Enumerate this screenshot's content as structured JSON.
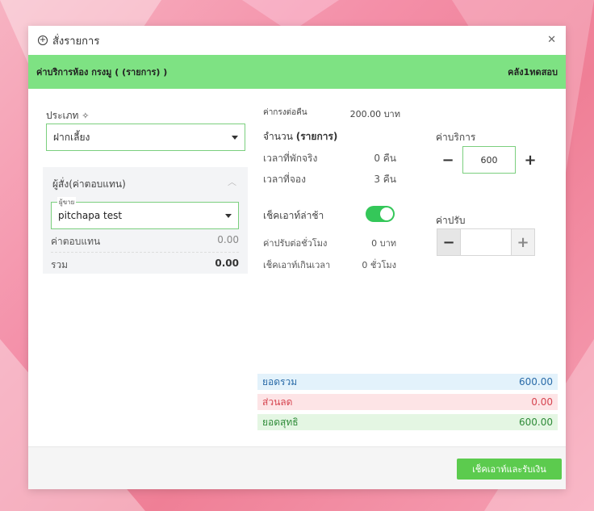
{
  "modal": {
    "title": "สั่งรายการ",
    "bar_left": "ค่าบริการห้อง กรงมู ( (รายการ) )",
    "bar_right": "คลัง1ทดสอบ"
  },
  "left": {
    "type_label": "ประเภท",
    "type_value": "ฝากเลี้ยง",
    "panel_title": "ผู้สั่ง(ค่าตอบแทน)",
    "seller_legend": "ผู้ขาย",
    "seller_value": "pitchapa test",
    "commission_label": "ค่าตอบแทน",
    "commission_value": "0.00",
    "sum_label": "รวม",
    "sum_value": "0.00"
  },
  "middle": {
    "price_per_night_label": "ค่ากรงต่อคืน",
    "price_per_night_value": "200.00 บาท",
    "qty_label": "จำนวน",
    "qty_unit": "(รายการ)",
    "actual_stay_label": "เวลาที่พักจริง",
    "actual_stay_value": "0 คืน",
    "booked_label": "เวลาที่จอง",
    "booked_value": "3 คืน",
    "late_checkout_label": "เช็คเอาท์ล่าช้า",
    "late_checkout_on": true,
    "fine_per_hour_label": "ค่าปรับต่อชั่วโมง",
    "fine_per_hour_value": "0 บาท",
    "overtime_label": "เช็คเอาท์เกินเวลา",
    "overtime_value": "0 ชั่วโมง"
  },
  "right": {
    "service_label": "ค่าบริการ",
    "service_value": "600",
    "service_minus": "−",
    "service_plus": "+",
    "fine_label": "ค่าปรับ",
    "fine_value": "",
    "fine_minus": "−",
    "fine_plus": "+"
  },
  "totals": {
    "gross_label": "ยอดรวม",
    "gross_value": "600.00",
    "discount_label": "ส่วนลด",
    "discount_value": "0.00",
    "net_label": "ยอดสุทธิ",
    "net_value": "600.00"
  },
  "footer": {
    "checkout_button": "เช็คเอาท์และรับเงิน"
  },
  "colors": {
    "green_bar": "#7ee283",
    "primary": "#5ccb4e",
    "gross_bg": "#e3f2fb",
    "discount_bg": "#fde4e6",
    "net_bg": "#e4f6e3"
  },
  "icons": {
    "title_icon": "plus-circle-icon",
    "close": "close-icon",
    "type_info": "sparkle-icon",
    "panel_collapse": "chevron-up-icon"
  }
}
